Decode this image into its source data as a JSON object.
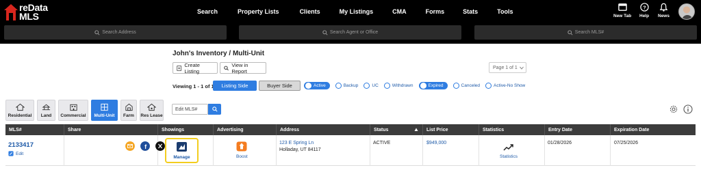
{
  "brand": {
    "logo_line1": "reData",
    "logo_line2": "MLS",
    "accent": "#2f7de1",
    "logo_red": "#d7261e",
    "highlight": "#f3cd1e"
  },
  "nav": {
    "items": [
      "Search",
      "Property Lists",
      "Clients",
      "My Listings",
      "CMA",
      "Forms",
      "Stats",
      "Tools"
    ],
    "right": [
      {
        "label": "New Tab",
        "icon": "new-tab-icon"
      },
      {
        "label": "Help",
        "icon": "help-icon"
      },
      {
        "label": "News",
        "icon": "bell-icon"
      }
    ]
  },
  "search": {
    "address_placeholder": "Search Address",
    "agent_placeholder": "Search Agent or Office",
    "mls_placeholder": "Search MLS#"
  },
  "inventory": {
    "title": "John's Inventory / Multi-Unit",
    "create_listing": "Create Listing",
    "view_report": "View in Report",
    "pager": "Page 1 of 1",
    "viewing": "Viewing 1 - 1 of 1",
    "listing_side": "Listing Side",
    "buyer_side": "Buyer Side",
    "statuses": [
      {
        "label": "Active",
        "selected": true
      },
      {
        "label": "Backup",
        "selected": false
      },
      {
        "label": "UC",
        "selected": false
      },
      {
        "label": "Withdrawn",
        "selected": false
      },
      {
        "label": "Expired",
        "selected": true
      },
      {
        "label": "Canceled",
        "selected": false
      },
      {
        "label": "Active-No Show",
        "selected": false
      }
    ]
  },
  "types": [
    {
      "label": "Residential",
      "icon": "house-icon",
      "active": false
    },
    {
      "label": "Land",
      "icon": "land-icon",
      "active": false
    },
    {
      "label": "Commercial",
      "icon": "commercial-icon",
      "active": false
    },
    {
      "label": "Multi-Unit",
      "icon": "multi-unit-icon",
      "active": true
    },
    {
      "label": "Farm",
      "icon": "farm-icon",
      "active": false
    },
    {
      "label": "Res Lease",
      "icon": "lease-icon",
      "active": false
    }
  ],
  "edit_mls_placeholder": "Edit MLS#",
  "table": {
    "headers": [
      "MLS#",
      "Share",
      "Showings",
      "Advertising",
      "Address",
      "Status",
      "List Price",
      "Statistics",
      "Entry Date",
      "Expiration Date"
    ],
    "row": {
      "mls": "2133417",
      "edit": "Edit",
      "manage": "Manage",
      "boost": "Boost",
      "address1": "123 E Spring Ln",
      "address2": "Holladay, UT 84117",
      "status": "ACTIVE",
      "price": "$949,000",
      "statistics": "Statistics",
      "entry": "01/28/2026",
      "expiration": "07/25/2026"
    }
  }
}
